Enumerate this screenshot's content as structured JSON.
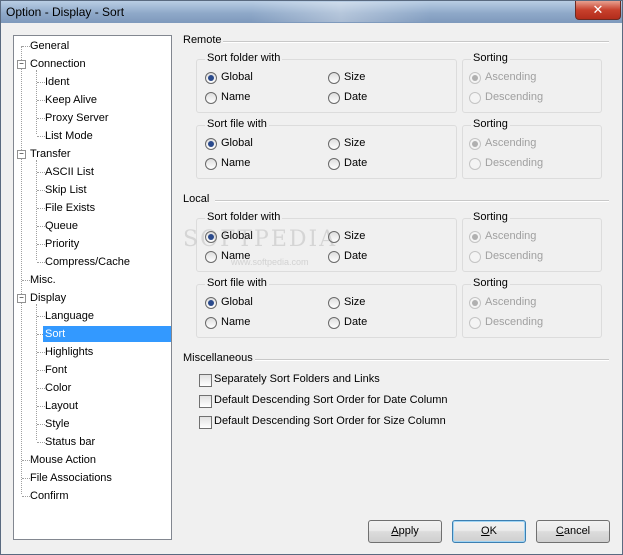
{
  "window": {
    "title": "Option - Display - Sort",
    "close_glyph": "✕"
  },
  "tree": {
    "items": [
      {
        "label": "General"
      },
      {
        "label": "Connection",
        "expander": "−"
      },
      {
        "label": "Ident"
      },
      {
        "label": "Keep Alive"
      },
      {
        "label": "Proxy Server"
      },
      {
        "label": "List Mode"
      },
      {
        "label": "Transfer",
        "expander": "−"
      },
      {
        "label": "ASCII List"
      },
      {
        "label": "Skip List"
      },
      {
        "label": "File Exists"
      },
      {
        "label": "Queue"
      },
      {
        "label": "Priority"
      },
      {
        "label": "Compress/Cache"
      },
      {
        "label": "Misc."
      },
      {
        "label": "Display",
        "expander": "−"
      },
      {
        "label": "Language"
      },
      {
        "label": "Sort",
        "selected": true
      },
      {
        "label": "Highlights"
      },
      {
        "label": "Font"
      },
      {
        "label": "Color"
      },
      {
        "label": "Layout"
      },
      {
        "label": "Style"
      },
      {
        "label": "Status bar"
      },
      {
        "label": "Mouse Action"
      },
      {
        "label": "File Associations"
      },
      {
        "label": "Confirm"
      }
    ]
  },
  "remote": {
    "label": "Remote",
    "folder": {
      "label": "Sort folder with",
      "global": "Global",
      "size": "Size",
      "name": "Name",
      "date": "Date"
    },
    "folder_sorting": {
      "label": "Sorting",
      "asc": "Ascending",
      "desc": "Descending"
    },
    "file": {
      "label": "Sort file with",
      "global": "Global",
      "size": "Size",
      "name": "Name",
      "date": "Date"
    },
    "file_sorting": {
      "label": "Sorting",
      "asc": "Ascending",
      "desc": "Descending"
    }
  },
  "local": {
    "label": "Local",
    "folder": {
      "label": "Sort folder with",
      "global": "Global",
      "size": "Size",
      "name": "Name",
      "date": "Date"
    },
    "folder_sorting": {
      "label": "Sorting",
      "asc": "Ascending",
      "desc": "Descending"
    },
    "file": {
      "label": "Sort file with",
      "global": "Global",
      "size": "Size",
      "name": "Name",
      "date": "Date"
    },
    "file_sorting": {
      "label": "Sorting",
      "asc": "Ascending",
      "desc": "Descending"
    }
  },
  "misc": {
    "label": "Miscellaneous",
    "opt1": "Separately Sort Folders and Links",
    "opt2": "Default Descending Sort Order for Date Column",
    "opt3": "Default Descending Sort Order for Size Column"
  },
  "buttons": {
    "apply_a": "A",
    "apply_b": "pply",
    "ok_a": "O",
    "ok_b": "K",
    "cancel_a": "C",
    "cancel_b": "ancel"
  },
  "watermark": {
    "logo": "SOFTPEDIA",
    "url": "www.softpedia.com"
  }
}
